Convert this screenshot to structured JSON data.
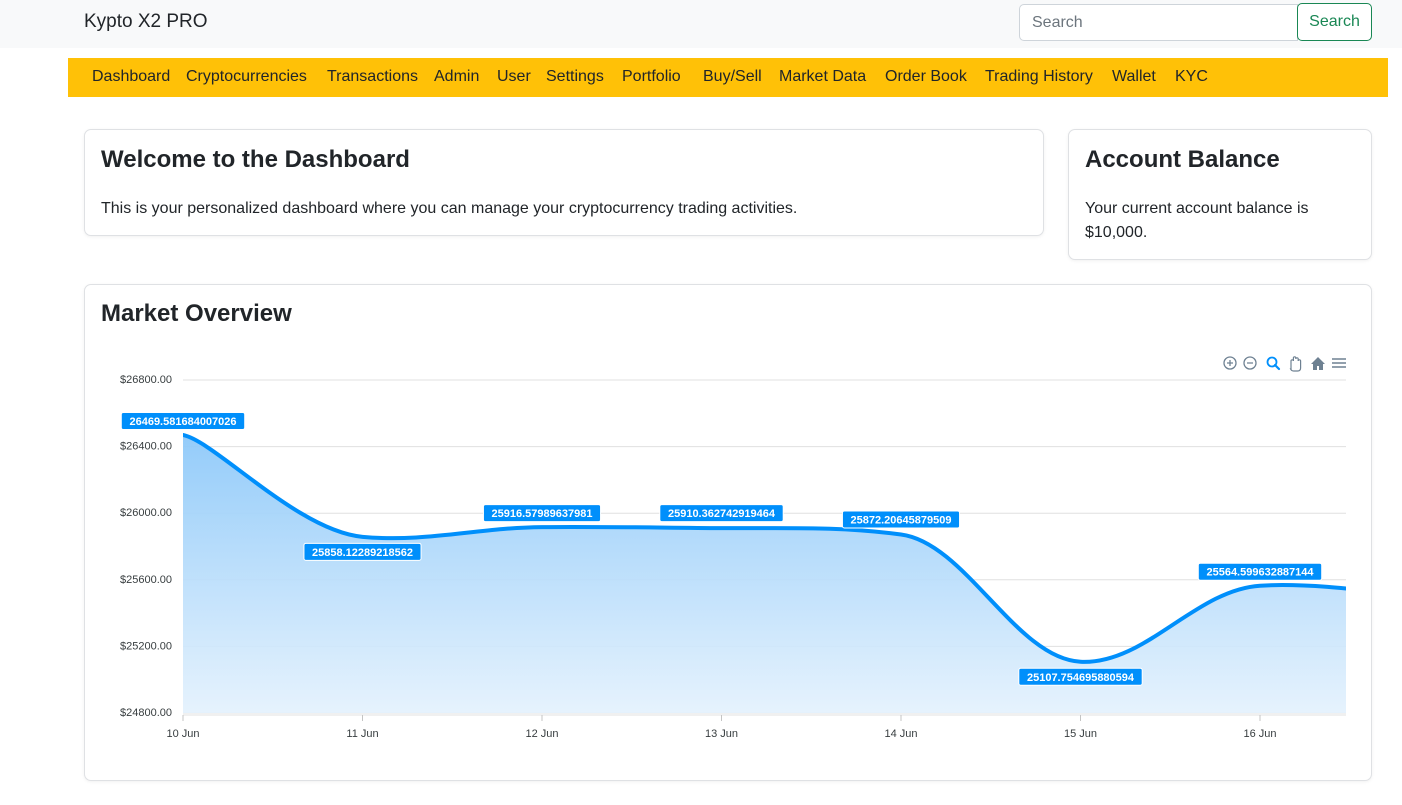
{
  "brand": "Kypto X2 PRO",
  "search": {
    "placeholder": "Search",
    "button_label": "Search"
  },
  "nav": {
    "items": [
      "Dashboard",
      "Cryptocurrencies",
      "Transactions",
      "Admin",
      "User",
      "Settings",
      "Portfolio",
      "Buy/Sell",
      "Market Data",
      "Order Book",
      "Trading History",
      "Wallet",
      "KYC"
    ]
  },
  "welcome": {
    "title": "Welcome to the Dashboard",
    "text": "This is your personalized dashboard where you can manage your cryptocurrency trading activities."
  },
  "balance": {
    "title": "Account Balance",
    "text_line1": "Your current account balance is",
    "text_line2": "$10,000."
  },
  "market": {
    "title": "Market Overview"
  },
  "colors": {
    "accent": "#ffc107",
    "series": "#008ffb",
    "success": "#198754"
  },
  "chart_toolbar": [
    "zoom-in-icon",
    "zoom-out-icon",
    "selection-zoom-icon",
    "pan-hand-icon",
    "home-icon",
    "menu-icon"
  ],
  "chart_data": {
    "type": "area",
    "x": [
      "10 Jun",
      "11 Jun",
      "12 Jun",
      "13 Jun",
      "14 Jun",
      "15 Jun",
      "16 Jun"
    ],
    "x_tick_labels": [
      "10 Jun",
      "11 Jun",
      "12 Jun",
      "13 Jun",
      "14 Jun",
      "15 Jun",
      "16 Jun"
    ],
    "series": [
      {
        "values": [
          26469.581684007026,
          25858.12289218562,
          25916.57989637981,
          25910.362742919464,
          25872.20645879509,
          25107.754695880594,
          25564.599632887144
        ],
        "labels": [
          "26469.581684007026",
          "25858.12289218562",
          "25916.57989637981",
          "25910.362742919464",
          "25872.20645879509",
          "25107.754695880594",
          "25564.599632887144"
        ],
        "trailing_value": 25490
      }
    ],
    "ylim": [
      24800,
      26800
    ],
    "y_ticks": [
      24800,
      25200,
      25600,
      26000,
      26400,
      26800
    ],
    "y_tick_labels": [
      "$24800.00",
      "$25200.00",
      "$25600.00",
      "$26000.00",
      "$26400.00",
      "$26800.00"
    ],
    "grid": true,
    "data_labels": true
  }
}
